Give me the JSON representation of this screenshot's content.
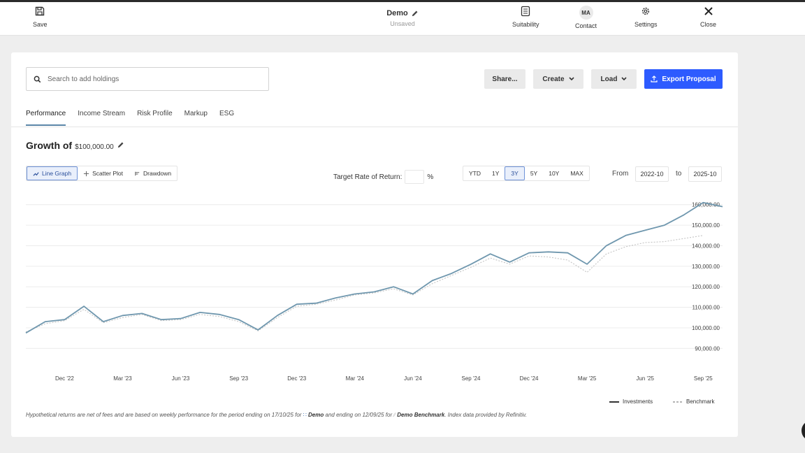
{
  "toolbar": {
    "save_label": "Save",
    "title": "Demo",
    "status": "Unsaved",
    "suitability_label": "Suitability",
    "contact_label": "Contact",
    "contact_initials": "MA",
    "settings_label": "Settings",
    "close_label": "Close"
  },
  "search": {
    "placeholder": "Search to add holdings"
  },
  "actions": {
    "share": "Share...",
    "create": "Create",
    "load": "Load",
    "export": "Export Proposal"
  },
  "tabs": [
    {
      "label": "Performance",
      "active": true
    },
    {
      "label": "Income Stream"
    },
    {
      "label": "Risk Profile"
    },
    {
      "label": "Markup"
    },
    {
      "label": "ESG"
    }
  ],
  "growth": {
    "title": "Growth of",
    "amount": "$100,000.00"
  },
  "view_modes": [
    {
      "label": "Line Graph",
      "active": true
    },
    {
      "label": "Scatter Plot"
    },
    {
      "label": "Drawdown"
    }
  ],
  "target_return": {
    "label": "Target Rate of Return:",
    "value": "",
    "unit": "%"
  },
  "periods": [
    {
      "label": "YTD"
    },
    {
      "label": "1Y"
    },
    {
      "label": "3Y",
      "active": true
    },
    {
      "label": "5Y"
    },
    {
      "label": "10Y"
    },
    {
      "label": "MAX"
    }
  ],
  "range": {
    "from_label": "From",
    "from": "2022-10",
    "to_label": "to",
    "to": "2025-10"
  },
  "legend": {
    "investments": "Investments",
    "benchmark": "Benchmark"
  },
  "disclaimer": {
    "p1": "Hypothetical returns are net of fees and are based on weekly performance for the period ending on 17/10/25 for",
    "portfolio": "Demo",
    "p2": "and ending on 12/09/25 for",
    "benchmark": "Demo Benchmark",
    "p3": ". Index data provided by Refinitiv."
  },
  "colors": {
    "investments": "#6f97ae",
    "benchmark": "#c4c4c4",
    "accent": "#2d5bff"
  },
  "chart_data": {
    "type": "line",
    "ylim": [
      85000,
      165000
    ],
    "xlim": [
      "2022-10",
      "2025-10"
    ],
    "y_ticks": [
      90000,
      100000,
      110000,
      120000,
      130000,
      140000,
      150000,
      160000
    ],
    "y_tick_labels": [
      "90,000.00",
      "100,000.00",
      "110,000.00",
      "120,000.00",
      "130,000.00",
      "140,000.00",
      "150,000.00",
      "160,000.00"
    ],
    "x_tick_labels": [
      "Dec '22",
      "Mar '23",
      "Jun '23",
      "Sep '23",
      "Dec '23",
      "Mar '24",
      "Jun '24",
      "Sep '24",
      "Dec '24",
      "Mar '25",
      "Jun '25",
      "Sep '25"
    ],
    "x_tick_dates": [
      "2022-12",
      "2023-03",
      "2023-06",
      "2023-09",
      "2023-12",
      "2024-03",
      "2024-06",
      "2024-09",
      "2024-12",
      "2025-03",
      "2025-06",
      "2025-09"
    ],
    "series": [
      {
        "name": "Investments",
        "dash": false,
        "x": [
          "2022-10",
          "2022-11",
          "2022-12",
          "2023-01",
          "2023-02",
          "2023-03",
          "2023-04",
          "2023-05",
          "2023-06",
          "2023-07",
          "2023-08",
          "2023-09",
          "2023-10",
          "2023-11",
          "2023-12",
          "2024-01",
          "2024-02",
          "2024-03",
          "2024-04",
          "2024-05",
          "2024-06",
          "2024-07",
          "2024-08",
          "2024-09",
          "2024-10",
          "2024-11",
          "2024-12",
          "2025-01",
          "2025-02",
          "2025-03",
          "2025-04",
          "2025-05",
          "2025-06",
          "2025-07",
          "2025-08",
          "2025-09",
          "2025-10"
        ],
        "y": [
          97500,
          103000,
          104000,
          110500,
          103000,
          106000,
          107000,
          104000,
          104500,
          107500,
          106500,
          104000,
          99000,
          106000,
          111500,
          112000,
          114500,
          116500,
          117500,
          120000,
          116500,
          123000,
          126500,
          131000,
          136000,
          132000,
          136500,
          137000,
          136500,
          131000,
          140000,
          145000,
          147500,
          150000,
          155000,
          161000,
          159000
        ]
      },
      {
        "name": "Benchmark",
        "dash": true,
        "x": [
          "2022-10",
          "2022-11",
          "2022-12",
          "2023-01",
          "2023-02",
          "2023-03",
          "2023-04",
          "2023-05",
          "2023-06",
          "2023-07",
          "2023-08",
          "2023-09",
          "2023-10",
          "2023-11",
          "2023-12",
          "2024-01",
          "2024-02",
          "2024-03",
          "2024-04",
          "2024-05",
          "2024-06",
          "2024-07",
          "2024-08",
          "2024-09",
          "2024-10",
          "2024-11",
          "2024-12",
          "2025-01",
          "2025-02",
          "2025-03",
          "2025-04",
          "2025-05",
          "2025-06",
          "2025-07",
          "2025-08",
          "2025-09"
        ],
        "y": [
          98000,
          102000,
          103500,
          109000,
          102500,
          105000,
          106500,
          103500,
          104000,
          106500,
          105500,
          103000,
          98500,
          105000,
          110500,
          111500,
          113500,
          116000,
          117000,
          119000,
          116000,
          121500,
          125500,
          129500,
          134000,
          131000,
          135000,
          134500,
          133000,
          127000,
          136000,
          139500,
          141500,
          142000,
          143500,
          145000
        ]
      }
    ]
  }
}
